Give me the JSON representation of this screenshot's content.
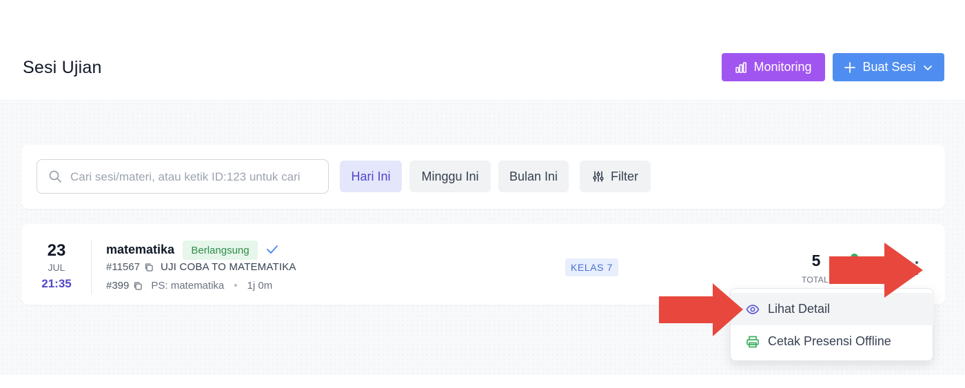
{
  "header": {
    "title": "Sesi Ujian",
    "monitoring_label": "Monitoring",
    "buat_sesi_label": "Buat Sesi"
  },
  "search": {
    "placeholder": "Cari sesi/materi, atau ketik ID:123 untuk cari",
    "value": ""
  },
  "filters": {
    "today": "Hari Ini",
    "week": "Minggu Ini",
    "month": "Bulan Ini",
    "filter": "Filter"
  },
  "session": {
    "day": "23",
    "month": "JUL",
    "time": "21:35",
    "subject": "matematika",
    "status": "Berlangsung",
    "exam_id": "#11567",
    "exam_title": "UJI COBA TO MATEMATIKA",
    "package_id": "#399",
    "package": "PS: matematika",
    "duration": "1j 0m",
    "class": "KELAS 7",
    "total": "5",
    "total_label": "TOTAL"
  },
  "menu": {
    "items": [
      {
        "label": "Lihat Detail",
        "icon": "eye-icon"
      },
      {
        "label": "Cetak Presensi Offline",
        "icon": "printer-icon"
      }
    ]
  },
  "colors": {
    "monitoring": "#a155f0",
    "buat_sesi": "#4f8ef0",
    "accent": "#4f46c8",
    "status_green": "#2e8b4a",
    "annotation_arrow": "#e8473d"
  }
}
